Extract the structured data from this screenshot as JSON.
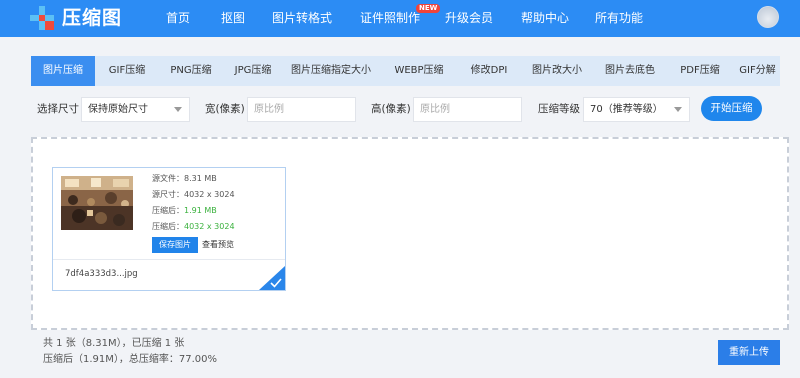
{
  "header": {
    "app_name": "压缩图",
    "nav": [
      "首页",
      "抠图",
      "图片转格式",
      "证件照制作",
      "升级会员",
      "帮助中心",
      "所有功能"
    ],
    "new_badge": "NEW",
    "colors": {
      "bar": "#2c8cf4",
      "logo_blue": "#5cc0f5",
      "logo_red": "#f04a3d",
      "badge": "#f0443a"
    },
    "avatar_icon": "user-avatar"
  },
  "tabs": {
    "items": [
      "图片压缩",
      "GIF压缩",
      "PNG压缩",
      "JPG压缩",
      "图片压缩指定大小",
      "WEBP压缩",
      "修改DPI",
      "图片改大小",
      "图片去底色",
      "PDF压缩",
      "GIF分解"
    ],
    "active_index": 0
  },
  "options": {
    "size_label": "选择尺寸",
    "size_value": "保持原始尺寸",
    "width_label": "宽(像素)",
    "width_placeholder": "原比例",
    "height_label": "高(像素)",
    "height_placeholder": "原比例",
    "level_label": "压缩等级",
    "level_value": "70（推荐等级）",
    "start_button": "开始压缩"
  },
  "file": {
    "source_size": "源文件：8.31 MB",
    "source_dims": "源尺寸：4032 x 3024",
    "compressed_size_label": "压缩后：",
    "compressed_size_value": "1.91 MB",
    "compressed_dims_label": "压缩后：",
    "compressed_dims_value": "4032 x 3024",
    "save_button": "保存图片",
    "preview_link": "查看预览",
    "filename": "7df4a333d3...jpg",
    "status_icon": "check-icon"
  },
  "summary": {
    "line1": "共 1 张（8.31M），已压缩 1 张",
    "line2": "压缩后（1.91M），总压缩率：77.00%",
    "reupload_button": "重新上传"
  }
}
